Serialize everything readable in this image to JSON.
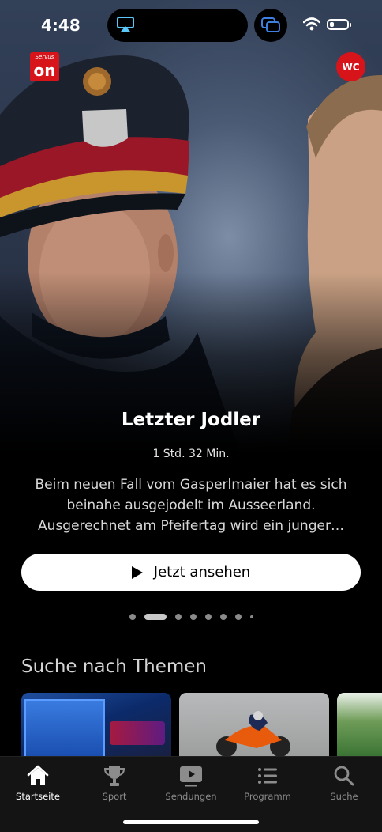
{
  "status_bar": {
    "time": "4:48",
    "battery_level": 0.25,
    "icons": [
      "airplay-icon",
      "screen-mirror-icon",
      "wifi-icon",
      "battery-icon"
    ]
  },
  "header": {
    "logo_small": "Servus",
    "logo_big": "on",
    "avatar_initials": "WC"
  },
  "hero": {
    "title": "Letzter Jodler",
    "duration": "1 Std. 32 Min.",
    "description": "Beim neuen Fall vom Gasperlmaier hat es sich beinahe ausgejodelt im Ausseerland. Ausgerechnet am Pfeifertag wird ein junger…",
    "watch_label": "Jetzt ansehen",
    "carousel_total": 8,
    "carousel_active": 2
  },
  "topics": {
    "title": "Suche nach Themen"
  },
  "tabbar": {
    "items": [
      {
        "label": "Startseite",
        "icon": "home-icon",
        "active": true
      },
      {
        "label": "Sport",
        "icon": "trophy-icon",
        "active": false
      },
      {
        "label": "Sendungen",
        "icon": "play-screen-icon",
        "active": false
      },
      {
        "label": "Programm",
        "icon": "list-icon",
        "active": false
      },
      {
        "label": "Suche",
        "icon": "search-icon",
        "active": false
      }
    ]
  },
  "colors": {
    "brand_red": "#d8141b",
    "background": "#000000",
    "tabbar_bg": "#141414",
    "inactive_tab": "#8c8c8c"
  }
}
